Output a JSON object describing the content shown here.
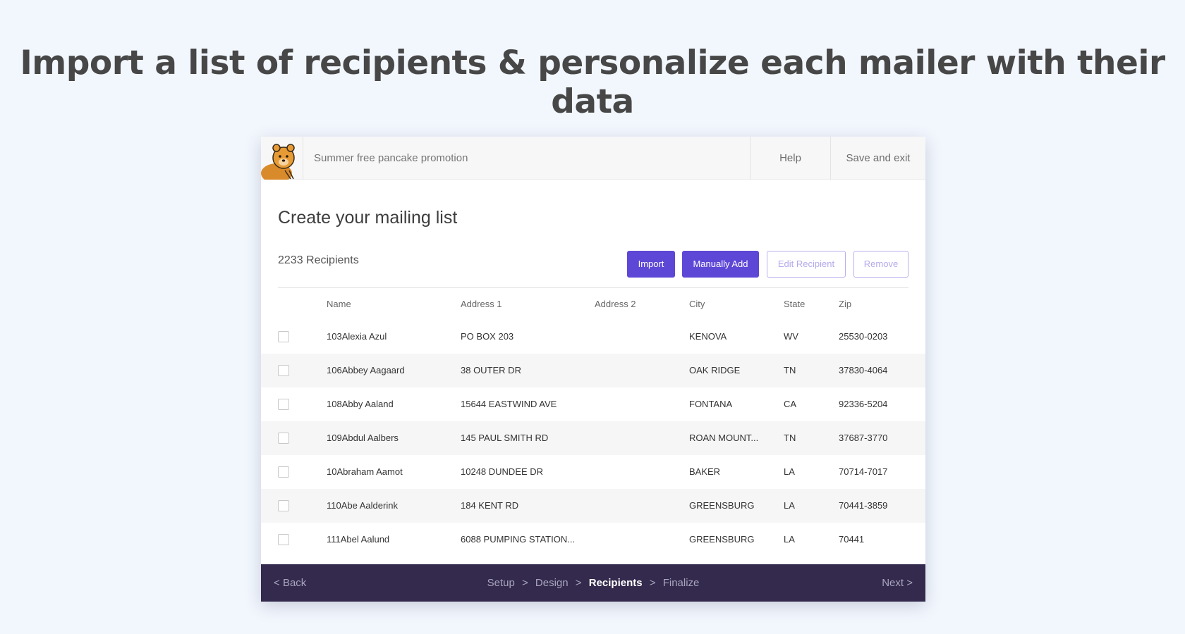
{
  "headline": "Import a list of recipients & personalize each mailer with their data",
  "topbar": {
    "campaign_title": "Summer free pancake promotion",
    "help_label": "Help",
    "save_exit_label": "Save and exit"
  },
  "main": {
    "heading": "Create your mailing list",
    "recipient_count": "2233 Recipients",
    "buttons": {
      "import": "Import",
      "manual_add": "Manually Add",
      "edit": "Edit Recipient",
      "remove": "Remove"
    },
    "table": {
      "columns": [
        "Name",
        "Address 1",
        "Address 2",
        "City",
        "State",
        "Zip"
      ],
      "rows": [
        {
          "name": "103Alexia Azul",
          "address1": "PO BOX 203",
          "address2": "",
          "city": "KENOVA",
          "state": "WV",
          "zip": "25530-0203"
        },
        {
          "name": "106Abbey Aagaard",
          "address1": "38 OUTER DR",
          "address2": "",
          "city": "OAK RIDGE",
          "state": "TN",
          "zip": "37830-4064"
        },
        {
          "name": "108Abby Aaland",
          "address1": "15644 EASTWIND AVE",
          "address2": "",
          "city": "FONTANA",
          "state": "CA",
          "zip": "92336-5204"
        },
        {
          "name": "109Abdul Aalbers",
          "address1": "145 PAUL SMITH RD",
          "address2": "",
          "city": "ROAN MOUNT...",
          "state": "TN",
          "zip": "37687-3770"
        },
        {
          "name": "10Abraham Aamot",
          "address1": "10248 DUNDEE DR",
          "address2": "",
          "city": "BAKER",
          "state": "LA",
          "zip": "70714-7017"
        },
        {
          "name": "110Abe Aalderink",
          "address1": "184 KENT RD",
          "address2": "",
          "city": "GREENSBURG",
          "state": "LA",
          "zip": "70441-3859"
        },
        {
          "name": "111Abel Aalund",
          "address1": "6088 PUMPING STATION...",
          "address2": "",
          "city": "GREENSBURG",
          "state": "LA",
          "zip": "70441"
        }
      ]
    }
  },
  "footer": {
    "back_label": "Back",
    "next_label": "Next",
    "steps": [
      {
        "label": "Setup",
        "active": false
      },
      {
        "label": "Design",
        "active": false
      },
      {
        "label": "Recipients",
        "active": true
      },
      {
        "label": "Finalize",
        "active": false
      }
    ],
    "chevron_left": "<",
    "chevron_right": ">"
  },
  "colors": {
    "page_bg": "#f2f7fe",
    "accent": "#5d47d6",
    "footer_bg": "#332a4d"
  },
  "icons": {
    "logo": "bear-mascot-icon",
    "back": "chevron-left-icon",
    "next": "chevron-right-icon",
    "checkbox": "checkbox-icon"
  }
}
